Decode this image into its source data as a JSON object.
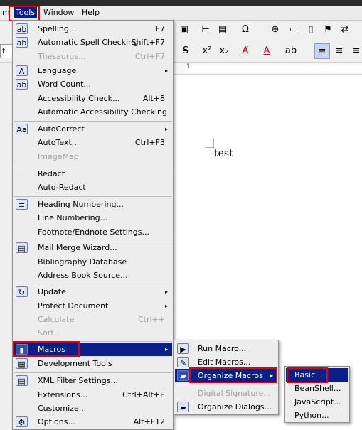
{
  "menubar": {
    "partial": "m",
    "tools": "Tools",
    "window": "Window",
    "help": "Help"
  },
  "toolbar": {
    "font_box_text": "f"
  },
  "document": {
    "text": "test",
    "ruler_mark": "1"
  },
  "tools_menu": {
    "items": [
      {
        "label": "Spelling...",
        "shortcut": "F7",
        "icon": "spelling-icon",
        "glyph": "ab"
      },
      {
        "label": "Automatic Spell Checking",
        "shortcut": "Shift+F7",
        "icon": "auto-spell-icon",
        "glyph": "ab"
      },
      {
        "label": "Thesaurus...",
        "shortcut": "Ctrl+F7",
        "icon": "",
        "glyph": ""
      },
      {
        "label": "Language",
        "shortcut": "",
        "icon": "language-icon",
        "glyph": "A"
      },
      {
        "label": "Word Count...",
        "shortcut": "",
        "icon": "word-count-icon",
        "glyph": "ab"
      },
      {
        "label": "Accessibility Check...",
        "shortcut": "Alt+8",
        "icon": "",
        "glyph": ""
      },
      {
        "label": "Automatic Accessibility Checking",
        "shortcut": "",
        "icon": "",
        "glyph": ""
      },
      {
        "label": "AutoCorrect",
        "shortcut": "",
        "icon": "autocorrect-icon",
        "glyph": "Aa"
      },
      {
        "label": "AutoText...",
        "shortcut": "Ctrl+F3",
        "icon": "",
        "glyph": ""
      },
      {
        "label": "ImageMap",
        "shortcut": "",
        "icon": "",
        "glyph": ""
      },
      {
        "label": "Redact",
        "shortcut": "",
        "icon": "",
        "glyph": ""
      },
      {
        "label": "Auto-Redact",
        "shortcut": "",
        "icon": "",
        "glyph": ""
      },
      {
        "label": "Heading Numbering...",
        "shortcut": "",
        "icon": "heading-numbering-icon",
        "glyph": "≡"
      },
      {
        "label": "Line Numbering...",
        "shortcut": "",
        "icon": "",
        "glyph": ""
      },
      {
        "label": "Footnote/Endnote Settings...",
        "shortcut": "",
        "icon": "",
        "glyph": ""
      },
      {
        "label": "Mail Merge Wizard...",
        "shortcut": "",
        "icon": "mail-merge-icon",
        "glyph": "▤"
      },
      {
        "label": "Bibliography Database",
        "shortcut": "",
        "icon": "",
        "glyph": ""
      },
      {
        "label": "Address Book Source...",
        "shortcut": "",
        "icon": "",
        "glyph": ""
      },
      {
        "label": "Update",
        "shortcut": "",
        "icon": "update-icon",
        "glyph": "↻"
      },
      {
        "label": "Protect Document",
        "shortcut": "",
        "icon": "",
        "glyph": ""
      },
      {
        "label": "Calculate",
        "shortcut": "Ctrl++",
        "icon": "",
        "glyph": ""
      },
      {
        "label": "Sort...",
        "shortcut": "",
        "icon": "",
        "glyph": ""
      },
      {
        "label": "Macros",
        "shortcut": "",
        "icon": "macros-icon",
        "glyph": "▮"
      },
      {
        "label": "Development Tools",
        "shortcut": "",
        "icon": "development-tools-icon",
        "glyph": "▦"
      },
      {
        "label": "XML Filter Settings...",
        "shortcut": "",
        "icon": "xml-filter-icon",
        "glyph": "▤"
      },
      {
        "label": "Extensions...",
        "shortcut": "Ctrl+Alt+E",
        "icon": "",
        "glyph": ""
      },
      {
        "label": "Customize...",
        "shortcut": "",
        "icon": "",
        "glyph": ""
      },
      {
        "label": "Options...",
        "shortcut": "Alt+F12",
        "icon": "options-gear-icon",
        "glyph": "⚙"
      }
    ]
  },
  "macros_menu": {
    "items": [
      {
        "label": "Run Macro...",
        "icon": "run-macro-icon",
        "glyph": "▶"
      },
      {
        "label": "Edit Macros...",
        "icon": "edit-macros-icon",
        "glyph": "✎"
      },
      {
        "label": "Organize Macros",
        "icon": "organize-macros-folder-icon",
        "glyph": "▰"
      },
      {
        "label": "Digital Signature...",
        "icon": "",
        "glyph": ""
      },
      {
        "label": "Organize Dialogs...",
        "icon": "organize-dialogs-folder-icon",
        "glyph": "▰"
      }
    ]
  },
  "organize_menu": {
    "items": [
      {
        "label": "Basic..."
      },
      {
        "label": "BeanShell..."
      },
      {
        "label": "JavaScript..."
      },
      {
        "label": "Python..."
      }
    ]
  },
  "colors": {
    "selection": "#0a1f88",
    "highlight_border": "#e00010"
  }
}
